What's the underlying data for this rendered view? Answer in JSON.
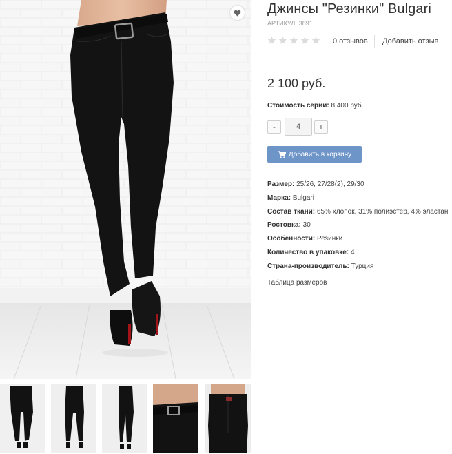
{
  "product": {
    "title": "Джинсы \"Резинки\" Bulgari",
    "sku_label": "АРТИКУЛ:",
    "sku_value": "3891",
    "rating": 0,
    "reviews_count": "0 отзывов",
    "add_review": "Добавить отзыв",
    "price": "2 100 руб.",
    "series_label": "Стоимость серии:",
    "series_value": "8 400 руб.",
    "quantity": "4",
    "qty_minus": "-",
    "qty_plus": "+",
    "add_to_cart": "Добавить в корзину",
    "size_table": "Таблица размеров"
  },
  "properties": [
    {
      "label": "Размер:",
      "value": "25/26, 27/28(2), 29/30"
    },
    {
      "label": "Марка:",
      "value": "Bulgari"
    },
    {
      "label": "Состав ткани:",
      "value": "65% хлопок, 31% полиэстер, 4% эластан"
    },
    {
      "label": "Ростовка:",
      "value": "30"
    },
    {
      "label": "Особенности:",
      "value": "Резинки"
    },
    {
      "label": "Количество в упаковке:",
      "value": "4"
    },
    {
      "label": "Страна-производитель:",
      "value": "Турция"
    }
  ],
  "icons": {
    "favorite": "heart-icon",
    "cart": "cart-icon",
    "rating": "star-icon"
  },
  "colors": {
    "button": "#6e95c8",
    "star_empty": "#dcdcdc",
    "text": "#333333",
    "muted": "#9a9a9a",
    "jeans": "#121212"
  },
  "thumbnails": [
    {
      "view": "front-full"
    },
    {
      "view": "back-full"
    },
    {
      "view": "side-full"
    },
    {
      "view": "waist-front-closeup"
    },
    {
      "view": "waist-back-closeup"
    }
  ]
}
